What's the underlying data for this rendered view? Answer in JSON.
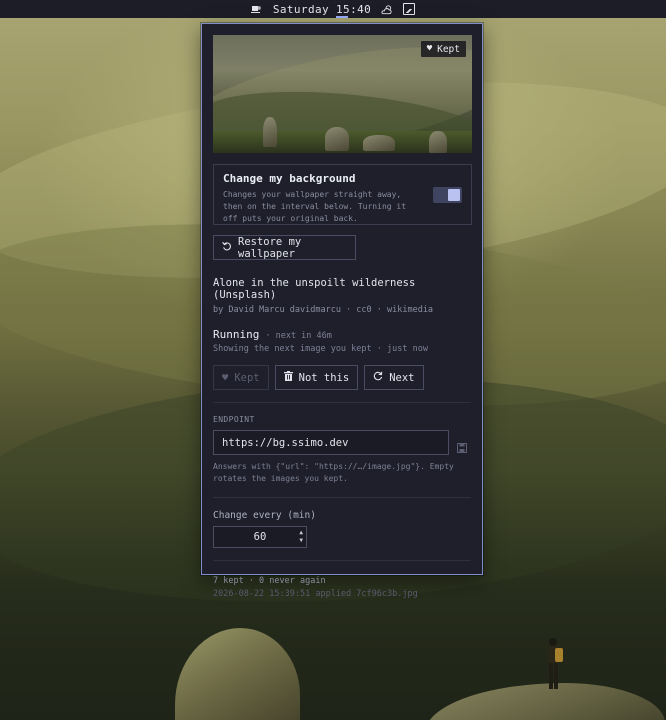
{
  "topbar": {
    "clock": "Saturday 15:40",
    "icons": [
      "coffee-icon",
      "weather-partly-cloudy-icon",
      "wallpaper-icon"
    ]
  },
  "panel": {
    "preview": {
      "badge": "Kept",
      "badge_icon": "heart-icon"
    },
    "change_background": {
      "title": "Change my background",
      "description": "Changes your wallpaper straight away, then on the interval below. Turning it off puts your original back.",
      "enabled": true
    },
    "restore_button": {
      "label": "Restore my wallpaper",
      "icon": "undo-icon"
    },
    "image": {
      "title": "Alone in the unspoilt wilderness (Unsplash)",
      "credit": "by David Marcu davidmarcu · cc0 · wikimedia"
    },
    "status": {
      "state": "Running",
      "next": "· next in 46m",
      "detail": "Showing the next image you kept · just now"
    },
    "actions": {
      "kept_label": "Kept",
      "not_this_label": "Not this",
      "next_label": "Next"
    },
    "endpoint": {
      "section_label": "ENDPOINT",
      "value": "https://bg.ssimo.dev",
      "help": "Answers with {\"url\": \"https://…/image.jpg\"}. Empty rotates the images you kept."
    },
    "interval": {
      "label": "Change every (min)",
      "value": "60"
    },
    "footer": {
      "counts": "7 kept · 0 never again",
      "applied": "2026-08-22 15:39:51 applied 7cf96c3b.jpg"
    }
  },
  "colors": {
    "panel_bg": "#1e1f2b",
    "panel_border": "#7e8ec8",
    "toggle_on": "#b9c2f0",
    "topbar_bg": "#1c1d27"
  }
}
